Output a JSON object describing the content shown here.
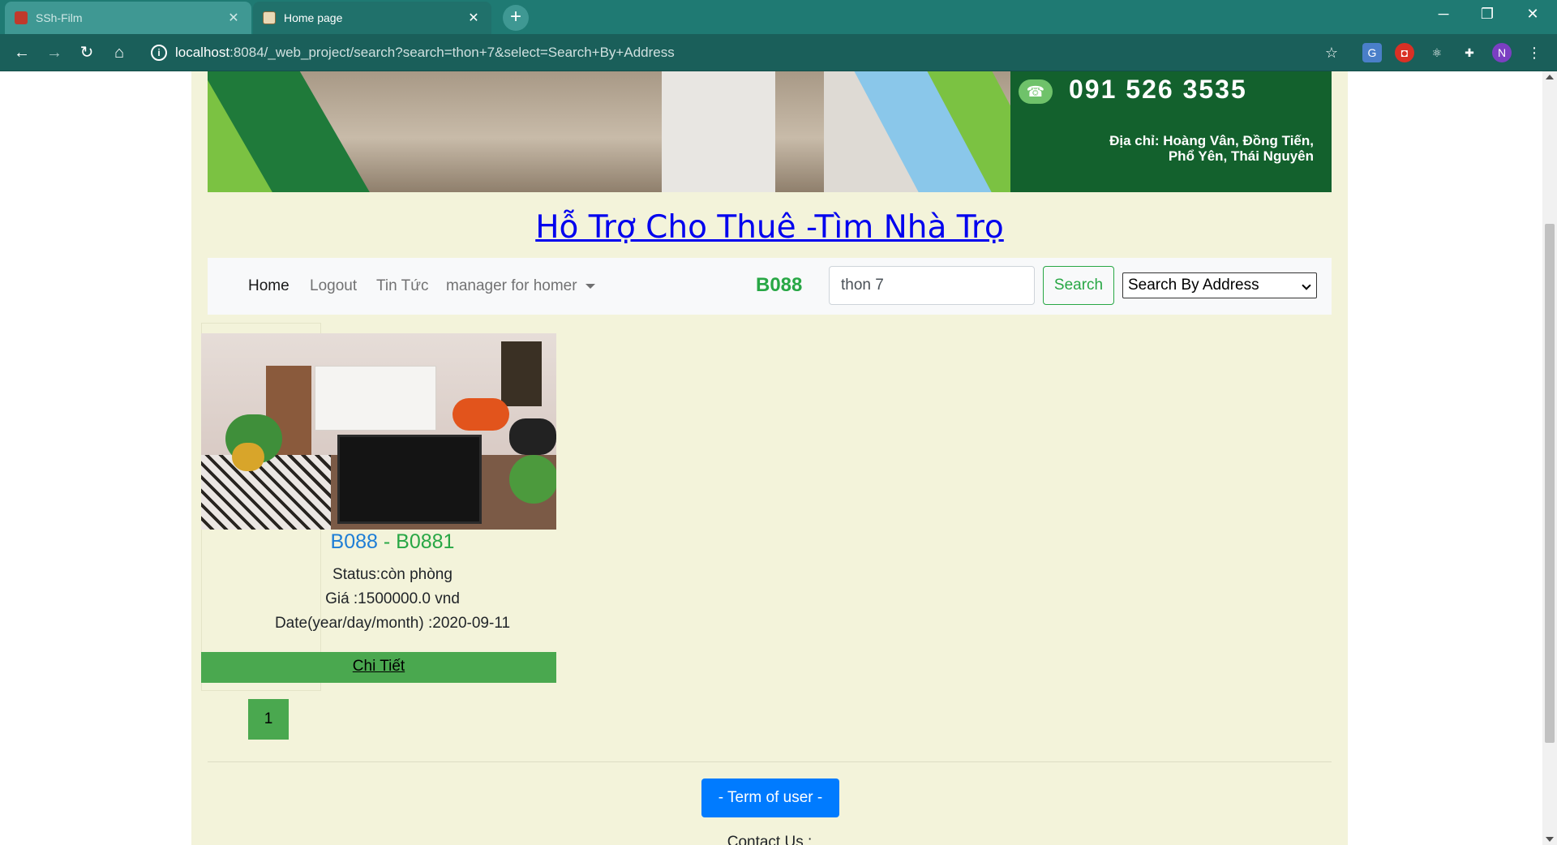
{
  "browser": {
    "tabs": [
      {
        "title": "SSh-Film",
        "active": false
      },
      {
        "title": "Home page",
        "active": true
      }
    ],
    "new_tab_label": "+",
    "url_host": "localhost",
    "url_path": ":8084/_web_project/search?search=thon+7&select=Search+By+Address",
    "profile_initial": "N",
    "colors": {
      "tabbar": "#1f7a73",
      "toolbar": "#1a5f5a"
    }
  },
  "banner": {
    "phone": "091 526 3535",
    "address_line1": "Địa chỉ: Hoàng Vân, Đồng Tiến,",
    "address_line2": "Phổ Yên, Thái Nguyên"
  },
  "site_title": "Hỗ Trợ Cho Thuê -Tìm Nhà Trọ",
  "navbar": {
    "home": "Home",
    "logout": "Logout",
    "news": "Tin Tức",
    "manager": "manager for homer",
    "user_code": "B088",
    "search_value": "thon 7",
    "search_button": "Search",
    "select_value": "Search By Address"
  },
  "listing": {
    "code1": "B088",
    "separator": " - ",
    "code2": "B0881",
    "status": "Status:còn phòng",
    "price": "Giá :1500000.0 vnd",
    "date": "Date(year/day/month) :2020-09-11",
    "detail_link": "Chi Tiết"
  },
  "pagination": {
    "current": "1"
  },
  "footer": {
    "term_button": "- Term of user -",
    "contact": "Contact Us :"
  },
  "colors": {
    "page_bg": "#f3f3da",
    "accent_green": "#28a745",
    "link_blue": "#0000ee",
    "term_blue": "#007bff"
  }
}
